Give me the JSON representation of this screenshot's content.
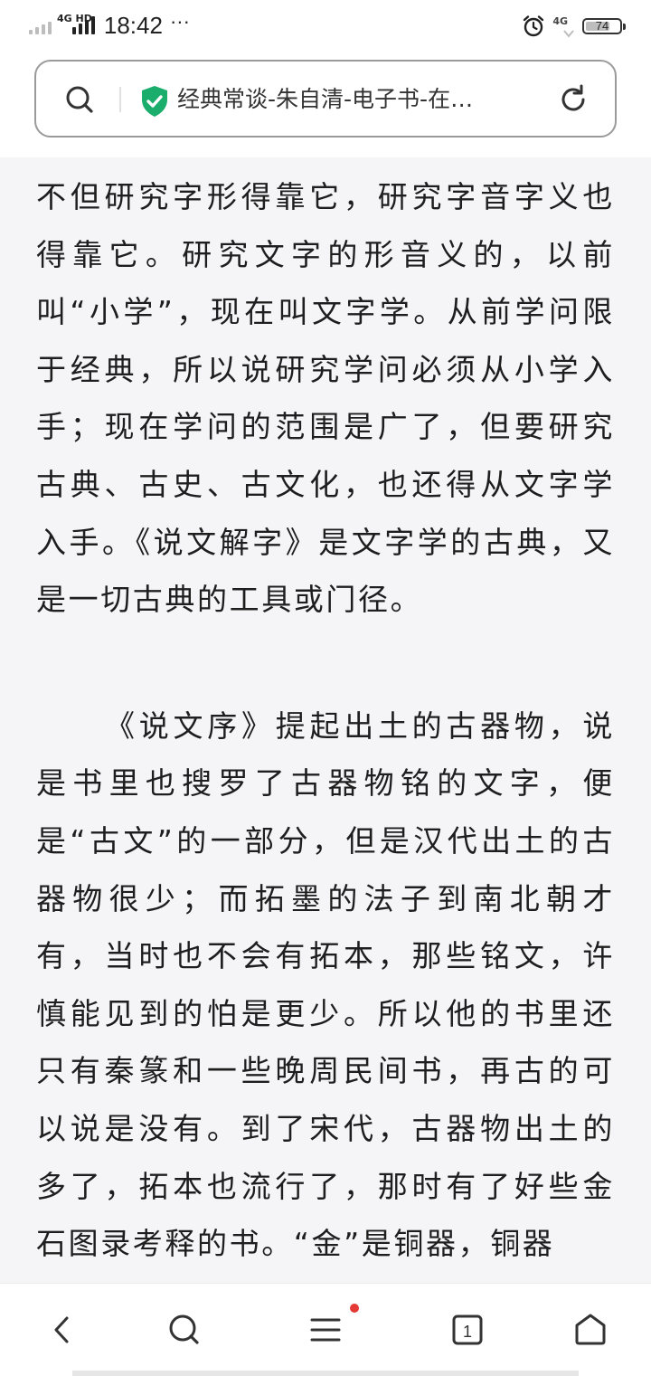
{
  "status_bar": {
    "network_label": "4G HD",
    "time": "18:42",
    "more_indicator": "···",
    "right_network_label": "4G",
    "battery_level": "74",
    "battery_fraction": 0.74
  },
  "address_bar": {
    "page_title": "经典常谈-朱自清-电子书-在…",
    "secure_color": "#1aad6b"
  },
  "article": {
    "paragraphs": [
      "不但研究字形得靠它，研究字音字义也得靠它。研究文字的形音义的，以前叫“小学”，现在叫文字学。从前学问限于经典，所以说研究学问必须从小学入手；现在学问的范围是广了，但要研究古典、古史、古文化，也还得从文字学入手。《说文解字》是文字学的古典，又是一切古典的工具或门径。",
      "《说文序》提起出土的古器物，说是书里也搜罗了古器物铭的文字，便是“古文”的一部分，但是汉代出土的古器物很少；而拓墨的法子到南北朝才有，当时也不会有拓本，那些铭文，许慎能见到的怕是更少。所以他的书里还只有秦篆和一些晚周民间书，再古的可以说是没有。到了宋代，古器物出土的多了，拓本也流行了，那时有了好些金石图录考释的书。“金”是铜器，铜器"
    ]
  },
  "bottom_nav": {
    "tab_count": "1",
    "notification_color": "#e53935"
  }
}
